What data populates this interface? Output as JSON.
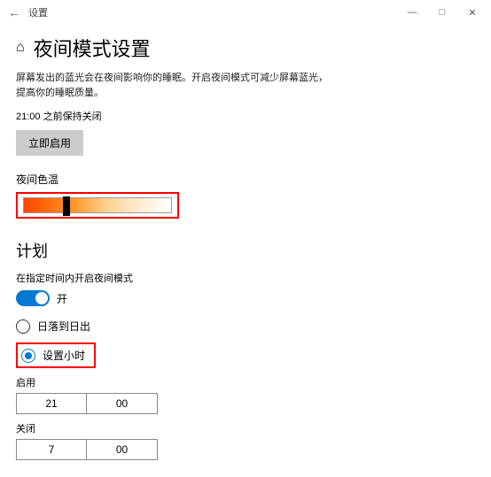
{
  "window": {
    "title": "设置"
  },
  "page": {
    "heading": "夜间模式设置",
    "description_line1": "屏幕发出的蓝光会在夜间影响你的睡眠。开启夜间模式可减少屏幕蓝光，",
    "description_line2": "提高你的睡眠质量。",
    "status": "21:00 之前保持关闭",
    "enable_now_btn": "立即启用"
  },
  "color_temp": {
    "label": "夜间色温",
    "value_percent": 28
  },
  "schedule": {
    "heading": "计划",
    "sub_label": "在指定时间内开启夜间模式",
    "toggle_on": true,
    "toggle_label": "开",
    "radio_sunset": "日落到日出",
    "radio_hours": "设置小时",
    "selected_radio": "hours",
    "start_label": "启用",
    "start_hour": "21",
    "start_min": "00",
    "end_label": "关闭",
    "end_hour": "7",
    "end_min": "00"
  }
}
